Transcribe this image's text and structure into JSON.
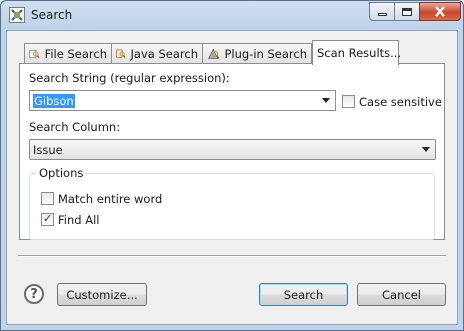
{
  "window": {
    "title": "Search"
  },
  "tabs": [
    {
      "label": "File Search",
      "icon": "file-search-icon"
    },
    {
      "label": "Java Search",
      "icon": "java-search-icon"
    },
    {
      "label": "Plug-in Search",
      "icon": "plugin-search-icon"
    },
    {
      "label": "Scan Results...",
      "icon": "",
      "active": true
    }
  ],
  "search_string": {
    "label": "Search String (regular expression):",
    "value": "Gibson"
  },
  "case_sensitive": {
    "label": "Case sensitive",
    "checked": false
  },
  "search_column": {
    "label": "Search Column:",
    "value": "Issue"
  },
  "options": {
    "legend": "Options",
    "match_entire_word": {
      "label": "Match entire word",
      "checked": false
    },
    "find_all": {
      "label": "Find All",
      "checked": true
    }
  },
  "buttons": {
    "customize": "Customize...",
    "search": "Search",
    "cancel": "Cancel"
  }
}
